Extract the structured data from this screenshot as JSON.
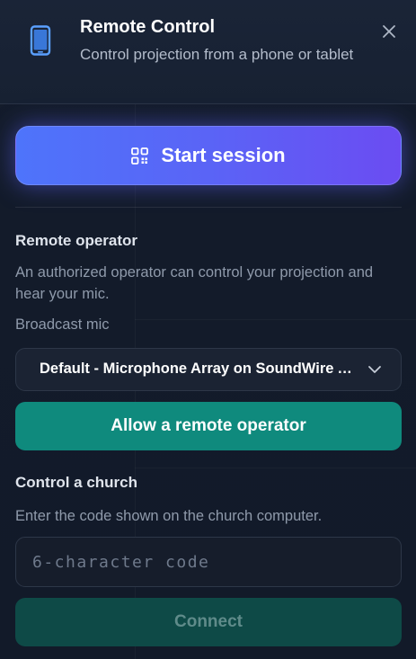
{
  "header": {
    "title": "Remote Control",
    "subtitle": "Control projection from a phone or tablet",
    "icon": "phone-icon",
    "close_icon": "close-icon"
  },
  "start_session": {
    "label": "Start session",
    "icon": "qr-code-icon"
  },
  "remote_operator": {
    "title": "Remote operator",
    "description": "An authorized operator can control your projection and hear your mic.",
    "mic_label": "Broadcast mic",
    "mic_selected": "Default - Microphone Array on SoundWire Audio",
    "allow_label": "Allow a remote operator"
  },
  "control_church": {
    "title": "Control a church",
    "description": "Enter the code shown on the church computer.",
    "code_value": "",
    "code_placeholder": "6-character code",
    "connect_label": "Connect"
  },
  "colors": {
    "accent_start": "#4e74fb",
    "accent_end": "#6b4cf2",
    "teal": "#0f8a7d",
    "teal_disabled": "#0e4a47",
    "panel_bg": "#131b2a"
  }
}
